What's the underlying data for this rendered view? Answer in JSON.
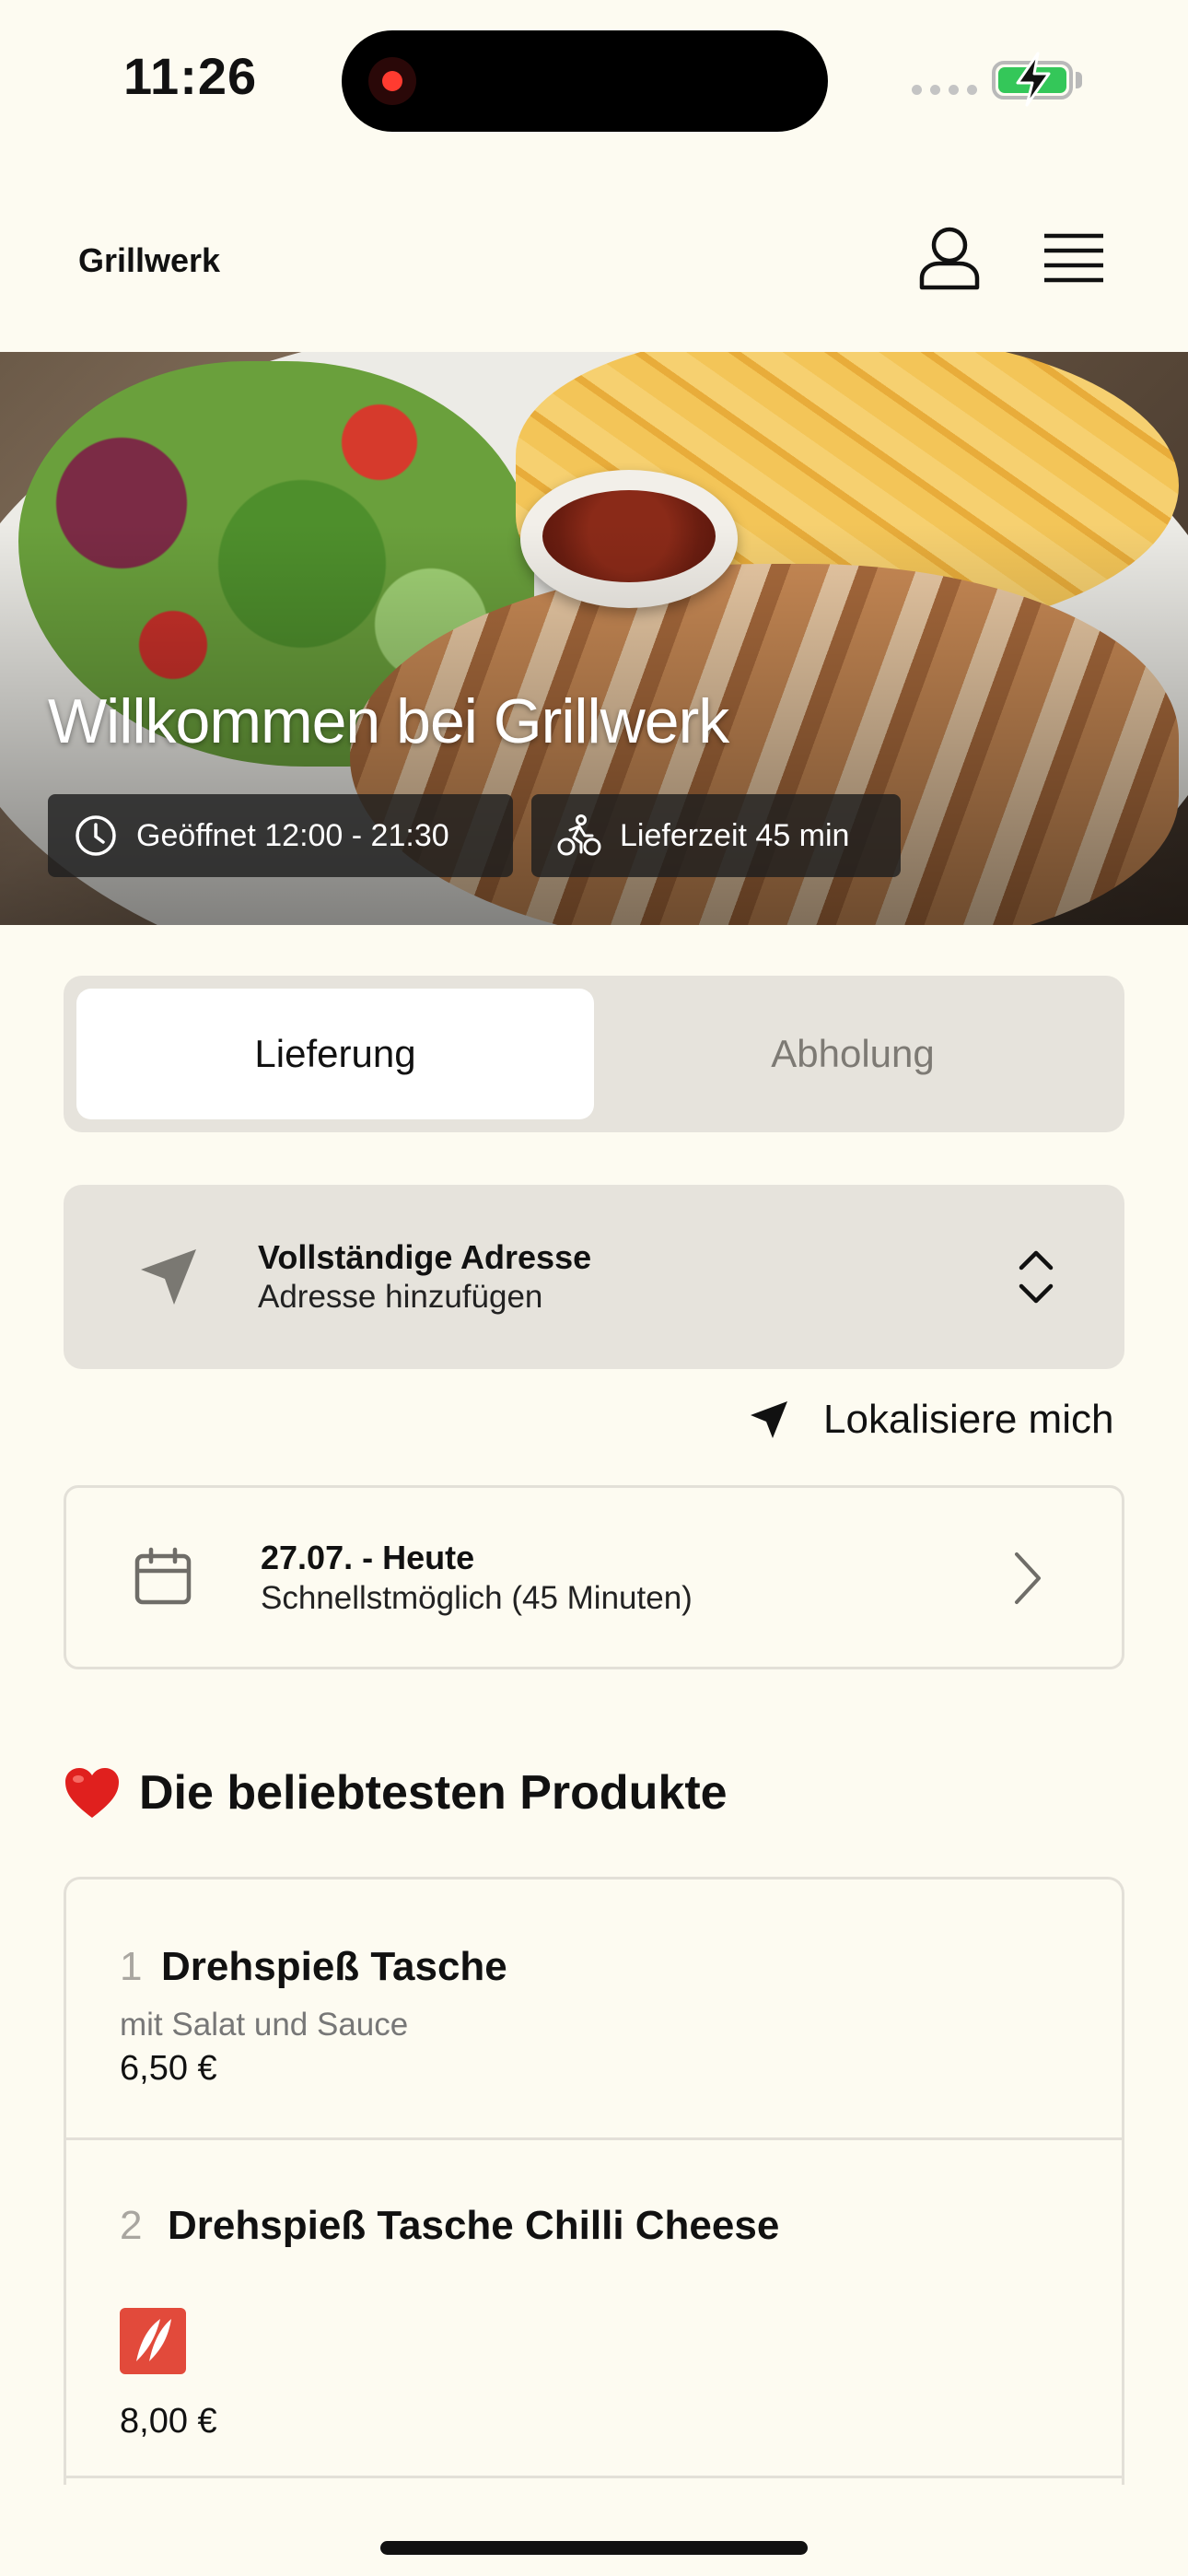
{
  "status_bar": {
    "time": "11:26"
  },
  "header": {
    "brand": "Grillwerk"
  },
  "hero": {
    "title": "Willkommen bei Grillwerk",
    "opening_hours": "Geöffnet 12:00 - 21:30",
    "delivery_time": "Lieferzeit 45 min"
  },
  "order_mode": {
    "options": [
      "Lieferung",
      "Abholung"
    ],
    "selected": "Lieferung"
  },
  "address": {
    "title": "Vollständige Adresse",
    "subtitle": "Adresse hinzufügen",
    "locate_label": "Lokalisiere mich"
  },
  "schedule": {
    "date": "27.07. - Heute",
    "time": "Schnellstmöglich (45 Minuten)"
  },
  "popular": {
    "heading": "Die beliebtesten Produkte",
    "products": [
      {
        "number": "1",
        "name": "Drehspieß Tasche",
        "description": "mit Salat und Sauce",
        "price": "6,50 €",
        "spicy": false
      },
      {
        "number": "2",
        "name": "Drehspieß Tasche Chilli Cheese",
        "description": "",
        "price": "8,00 €",
        "spicy": true
      }
    ]
  },
  "colors": {
    "background": "#fdfbf1",
    "segment_bg": "#e6e3dc",
    "battery": "#34c759",
    "spicy_badge": "#e24a3b",
    "heart": "#e0201e"
  },
  "icons": {
    "user": "user-icon",
    "menu": "menu-icon",
    "clock": "clock-icon",
    "bike": "bike-delivery-icon",
    "navigation": "navigation-arrow-icon",
    "chevrons": "chevron-up-down-icon",
    "calendar": "calendar-icon",
    "chevron_right": "chevron-right-icon",
    "heart": "heart-icon",
    "chili": "chili-icon"
  }
}
